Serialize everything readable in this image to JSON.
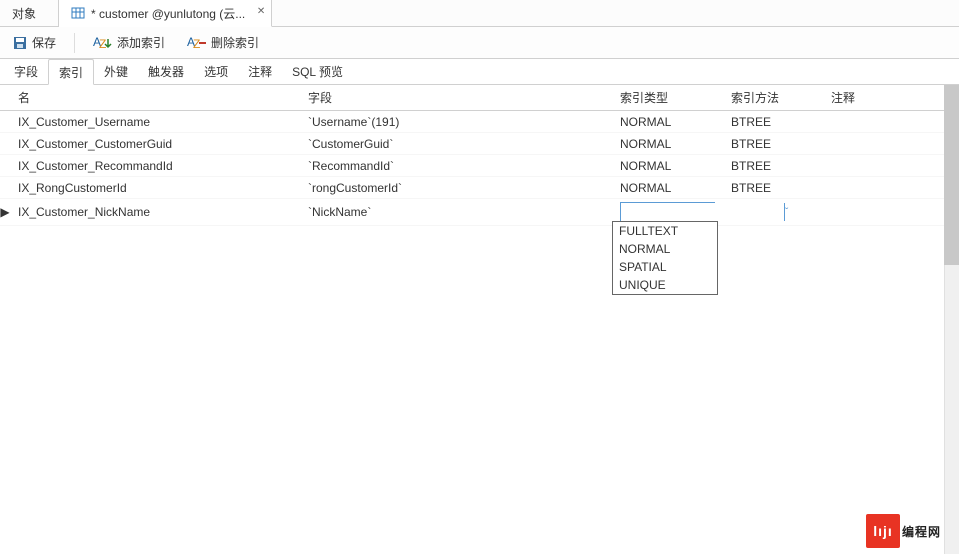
{
  "top_tabs": {
    "objects": "对象",
    "editor": "* customer @yunlutong (云..."
  },
  "toolbar": {
    "save": "保存",
    "add_index": "添加索引",
    "del_index": "删除索引"
  },
  "subtabs": {
    "fields": "字段",
    "indexes": "索引",
    "fk": "外键",
    "triggers": "触发器",
    "options": "选项",
    "comments": "注释",
    "sql": "SQL 预览"
  },
  "headers": {
    "name": "名",
    "fields": "字段",
    "type": "索引类型",
    "method": "索引方法",
    "comment": "注释"
  },
  "rows": [
    {
      "name": "IX_Customer_Username",
      "fields": "`Username`(191)",
      "type": "NORMAL",
      "method": "BTREE"
    },
    {
      "name": "IX_Customer_CustomerGuid",
      "fields": "`CustomerGuid`",
      "type": "NORMAL",
      "method": "BTREE"
    },
    {
      "name": "IX_Customer_RecommandId",
      "fields": "`RecommandId`",
      "type": "NORMAL",
      "method": "BTREE"
    },
    {
      "name": "IX_RongCustomerId",
      "fields": "`rongCustomerId`",
      "type": "NORMAL",
      "method": "BTREE"
    },
    {
      "name": "IX_Customer_NickName",
      "fields": "`NickName`",
      "type": "",
      "method": ""
    }
  ],
  "dropdown": [
    "FULLTEXT",
    "NORMAL",
    "SPATIAL",
    "UNIQUE"
  ],
  "watermark": {
    "logo": "lıjı",
    "text": "编程网"
  }
}
